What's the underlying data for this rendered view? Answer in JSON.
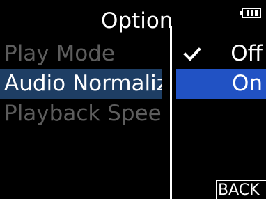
{
  "screen": {
    "title": "Option",
    "battery": {
      "icon": "battery-icon",
      "level": 0.75
    }
  },
  "menu": {
    "items": [
      {
        "label": "Play Mode",
        "selected": false
      },
      {
        "label": "Audio Normalization",
        "selected": true
      },
      {
        "label": "Playback Speed",
        "selected": false
      }
    ]
  },
  "options": {
    "items": [
      {
        "label": "Off",
        "checked": true,
        "highlighted": false
      },
      {
        "label": "On",
        "checked": false,
        "highlighted": true
      }
    ],
    "check_icon": "checkmark-icon"
  },
  "footer": {
    "back_label": "BACK"
  },
  "colors": {
    "background": "#000000",
    "text": "#ffffff",
    "inactive_text": "#5d5d5d",
    "menu_highlight": "#1e3e64",
    "option_highlight": "#2152c4"
  }
}
